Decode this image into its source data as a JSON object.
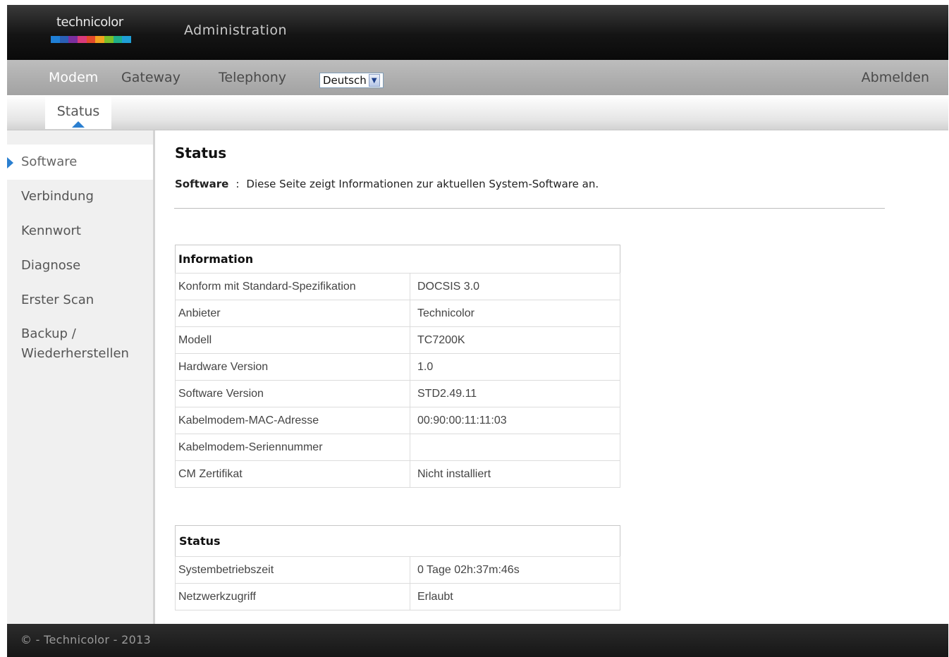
{
  "header": {
    "logo_text": "technicolor",
    "logo_colors": [
      "#1f7fd6",
      "#2a5fb5",
      "#7a2f9e",
      "#d93a7a",
      "#e24a2a",
      "#f2a21f",
      "#7bbf2a",
      "#1faf8a",
      "#1f9fd6"
    ],
    "title": "Administration"
  },
  "nav": {
    "items": [
      {
        "label": "Modem"
      },
      {
        "label": "Gateway"
      },
      {
        "label": "Telephony"
      }
    ],
    "language": "Deutsch",
    "logout": "Abmelden"
  },
  "subnav": {
    "tab": "Status"
  },
  "sidebar": {
    "items": [
      {
        "label": "Software"
      },
      {
        "label": "Verbindung"
      },
      {
        "label": "Kennwort"
      },
      {
        "label": "Diagnose"
      },
      {
        "label": "Erster Scan"
      },
      {
        "label": "Backup /"
      },
      {
        "label": "Wiederherstellen"
      }
    ]
  },
  "main": {
    "title": "Status",
    "desc_label": "Software",
    "desc_sep": ":",
    "desc_text": "Diese Seite zeigt Informationen zur aktuellen System-Software an.",
    "info_table": {
      "header": "Information",
      "rows": [
        {
          "label": "Konform mit Standard-Spezifikation",
          "value": "DOCSIS 3.0"
        },
        {
          "label": "Anbieter",
          "value": "Technicolor"
        },
        {
          "label": "Modell",
          "value": "TC7200K"
        },
        {
          "label": "Hardware Version",
          "value": "1.0"
        },
        {
          "label": "Software Version",
          "value": "STD2.49.11"
        },
        {
          "label": "Kabelmodem-MAC-Adresse",
          "value": "00:90:00:11:11:03"
        },
        {
          "label": "Kabelmodem-Seriennummer",
          "value": ""
        },
        {
          "label": "CM Zertifikat",
          "value": "Nicht installiert"
        }
      ]
    },
    "status_table": {
      "header": "Status",
      "rows": [
        {
          "label": "Systembetriebszeit",
          "value": "0 Tage 02h:37m:46s"
        },
        {
          "label": "Netzwerkzugriff",
          "value": "Erlaubt"
        }
      ]
    }
  },
  "footer": {
    "text": "© - Technicolor - 2013"
  }
}
